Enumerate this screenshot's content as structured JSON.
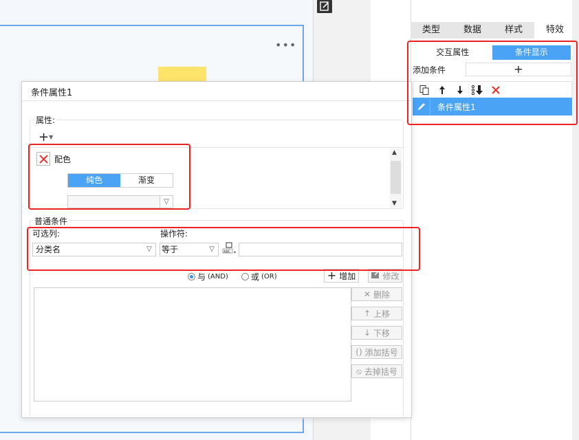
{
  "canvas": {
    "more_icon": "more-dots-icon",
    "edit_icon": "edit-icon"
  },
  "right_panel": {
    "tabs": [
      {
        "label": "类型"
      },
      {
        "label": "数据"
      },
      {
        "label": "样式"
      },
      {
        "label": "特效"
      }
    ],
    "active_tab": "特效",
    "subtabs": [
      {
        "label": "交互属性"
      },
      {
        "label": "条件显示"
      }
    ],
    "active_subtab": "条件显示",
    "add_condition_label": "添加条件",
    "add_condition_button": "+",
    "toolbar_icons": [
      "copy-icon",
      "arrow-up-icon",
      "arrow-down-icon",
      "move-to-bottom-icon",
      "delete-x-icon"
    ],
    "condition_items": [
      {
        "label": "条件属性1",
        "icon": "pencil-icon"
      }
    ]
  },
  "dialog": {
    "title": "条件属性1",
    "properties_label": "属性:",
    "add_button": "+",
    "property": {
      "name": "配色",
      "fill_tabs": [
        {
          "label": "纯色"
        },
        {
          "label": "渐变"
        }
      ],
      "active_fill": "纯色",
      "color_value": ""
    },
    "common": {
      "group_label": "普通条件",
      "column_label": "可选列:",
      "column_value": "分类名",
      "operator_label": "操作符:",
      "operator_value": "等于",
      "value_input": "",
      "and_label": "与",
      "and_suffix": "(AND)",
      "or_label": "或",
      "or_suffix": "(OR)",
      "and_selected": true,
      "add_button": "增加",
      "modify_button": "修改",
      "delete_button": "删除",
      "move_up_button": "上移",
      "move_down_button": "下移",
      "add_paren_button": "添加括号",
      "remove_paren_button": "去掉括号"
    }
  },
  "colors": {
    "accent": "#4aa3f5",
    "highlight": "#e22222",
    "yellow": "#ffe46b"
  }
}
